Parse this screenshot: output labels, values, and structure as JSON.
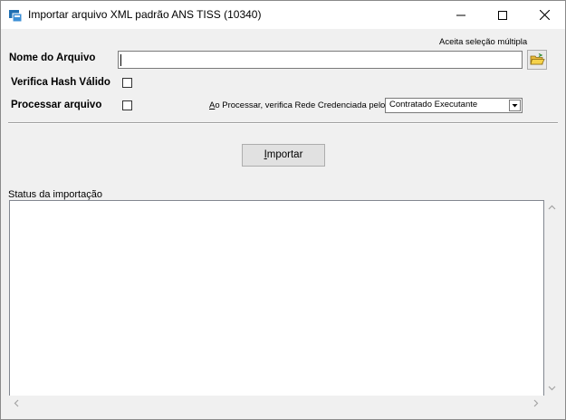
{
  "window": {
    "title": "Importar arquivo XML padrão ANS TISS (10340)",
    "controls": {
      "minimize": "minimize",
      "maximize": "maximize",
      "close": "close"
    }
  },
  "form": {
    "file_label": "Nome do Arquivo",
    "multi_select_hint": "Aceita seleção múltipla",
    "file_value": "",
    "hash_label": "Verifica Hash Válido",
    "hash_checked": false,
    "process_label": "Processar arquivo",
    "process_checked": false,
    "rede_label_accel": "A",
    "rede_label_rest": "o Processar,  verifica Rede Credenciada pelo",
    "rede_selected": "Contratado Executante"
  },
  "actions": {
    "import_accel": "I",
    "import_rest": "mportar"
  },
  "status": {
    "label": "Status da importação",
    "content": ""
  },
  "icons": {
    "app": "app-icon",
    "folder": "open-folder-icon",
    "colors": {
      "folder_yellow": "#f5d24a",
      "app_blue": "#1f6fb2"
    }
  }
}
